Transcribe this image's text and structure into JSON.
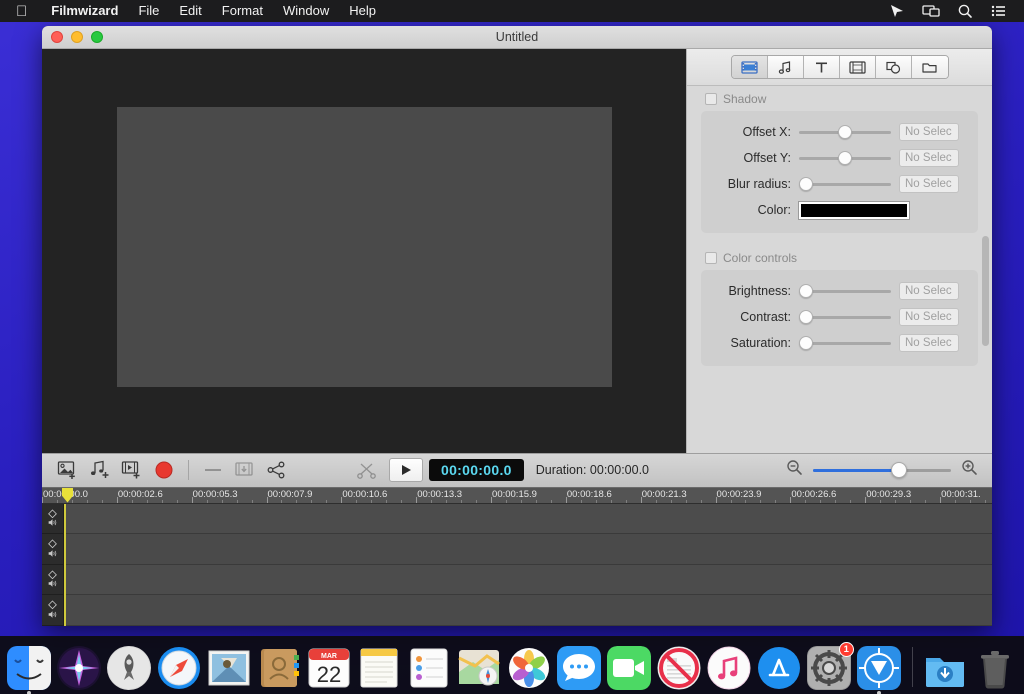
{
  "menubar": {
    "apple_glyph": " ",
    "items": [
      {
        "label": "Filmwizard",
        "bold": true
      },
      {
        "label": "File"
      },
      {
        "label": "Edit"
      },
      {
        "label": "Format"
      },
      {
        "label": "Window"
      },
      {
        "label": "Help"
      }
    ],
    "status_icons": [
      "pointer-icon",
      "screen-mirroring-icon",
      "search-icon",
      "control-center-icon"
    ]
  },
  "window": {
    "title": "Untitled",
    "traffic_lights": [
      "close",
      "minimize",
      "zoom"
    ]
  },
  "inspector": {
    "tabs": [
      {
        "name": "video-tab",
        "icon": "film-video-icon",
        "active": true
      },
      {
        "name": "audio-tab",
        "icon": "music-note-icon",
        "active": false
      },
      {
        "name": "text-tab",
        "icon": "text-t-icon",
        "active": false
      },
      {
        "name": "clip-tab",
        "icon": "film-strip-icon",
        "active": false
      },
      {
        "name": "shapes-tab",
        "icon": "shapes-icon",
        "active": false
      },
      {
        "name": "media-tab",
        "icon": "folder-icon",
        "active": false
      }
    ],
    "sections": [
      {
        "name": "shadow",
        "title": "Shadow",
        "checked": false,
        "rows": [
          {
            "label": "Offset X:",
            "type": "slider",
            "thumb_pct": 42,
            "value": "No Selec"
          },
          {
            "label": "Offset Y:",
            "type": "slider",
            "thumb_pct": 42,
            "value": "No Selec"
          },
          {
            "label": "Blur radius:",
            "type": "slider",
            "thumb_pct": 2,
            "value": "No Selec"
          },
          {
            "label": "Color:",
            "type": "color",
            "color": "#000000"
          }
        ]
      },
      {
        "name": "color-controls",
        "title": "Color controls",
        "checked": false,
        "rows": [
          {
            "label": "Brightness:",
            "type": "slider",
            "thumb_pct": 2,
            "value": "No Selec"
          },
          {
            "label": "Contrast:",
            "type": "slider",
            "thumb_pct": 2,
            "value": "No Selec"
          },
          {
            "label": "Saturation:",
            "type": "slider",
            "thumb_pct": 2,
            "value": "No Selec"
          }
        ]
      }
    ]
  },
  "transport": {
    "left_buttons": [
      {
        "name": "add-image-button",
        "icon": "add-image-icon"
      },
      {
        "name": "add-audio-button",
        "icon": "add-audio-icon"
      },
      {
        "name": "add-video-button",
        "icon": "add-video-icon"
      },
      {
        "name": "record-button",
        "icon": "record-icon",
        "color": "#e8382f"
      },
      {
        "name": "divider-button",
        "icon": "minus-icon"
      },
      {
        "name": "export-button",
        "icon": "export-clip-icon",
        "disabled": true
      },
      {
        "name": "share-button",
        "icon": "share-icon"
      }
    ],
    "split_button": {
      "name": "split-button",
      "icon": "scissors-icon",
      "disabled": true
    },
    "play_button": {
      "name": "play-button",
      "icon": "play-icon"
    },
    "timecode": "00:00:00.0",
    "duration_label": "Duration: 00:00:00.0",
    "zoom_out_icon": "zoom-out-icon",
    "zoom_in_icon": "zoom-in-icon",
    "zoom_value_pct": 62
  },
  "timeline": {
    "ruler_labels": [
      "00:00:00.0",
      "00:00:02.6",
      "00:00:05.3",
      "00:00:07.9",
      "00:00:10.6",
      "00:00:13.3",
      "00:00:15.9",
      "00:00:18.6",
      "00:00:21.3",
      "00:00:23.9",
      "00:00:26.6",
      "00:00:29.3",
      "00:00:31."
    ],
    "playhead_position": "00:00:00.0",
    "tracks": [
      {
        "name": "track-1",
        "keyframe_icon": "diamond-keyframe-icon",
        "volume_icon": "speaker-icon"
      },
      {
        "name": "track-2",
        "keyframe_icon": "diamond-keyframe-icon",
        "volume_icon": "speaker-icon"
      },
      {
        "name": "track-3",
        "keyframe_icon": "diamond-keyframe-icon",
        "volume_icon": "speaker-icon"
      },
      {
        "name": "track-4",
        "keyframe_icon": "diamond-keyframe-icon",
        "volume_icon": "speaker-icon"
      }
    ]
  },
  "dock": {
    "items": [
      {
        "name": "finder",
        "icon": "finder-icon",
        "running": true
      },
      {
        "name": "siri",
        "icon": "siri-icon",
        "running": false
      },
      {
        "name": "launchpad",
        "icon": "launchpad-icon",
        "running": false
      },
      {
        "name": "safari",
        "icon": "safari-icon",
        "running": false
      },
      {
        "name": "mail",
        "icon": "mail-icon",
        "running": false
      },
      {
        "name": "contacts",
        "icon": "contacts-icon",
        "running": false
      },
      {
        "name": "calendar",
        "icon": "calendar-icon",
        "running": false,
        "month": "MAR",
        "day": "22"
      },
      {
        "name": "notes",
        "icon": "notes-icon",
        "running": false
      },
      {
        "name": "reminders",
        "icon": "reminders-icon",
        "running": false
      },
      {
        "name": "maps",
        "icon": "maps-icon",
        "running": false
      },
      {
        "name": "photos",
        "icon": "photos-icon",
        "running": false
      },
      {
        "name": "messages",
        "icon": "messages-icon",
        "running": false
      },
      {
        "name": "facetime",
        "icon": "facetime-icon",
        "running": false
      },
      {
        "name": "news",
        "icon": "news-icon",
        "running": false
      },
      {
        "name": "itunes",
        "icon": "itunes-icon",
        "running": false
      },
      {
        "name": "app-store",
        "icon": "app-store-icon",
        "running": false
      },
      {
        "name": "system-preferences",
        "icon": "gear-icon",
        "running": false,
        "badge": "1"
      },
      {
        "name": "filmwizard",
        "icon": "filmwizard-icon",
        "running": true
      },
      {
        "name": "downloads",
        "icon": "downloads-folder-icon",
        "running": false
      },
      {
        "name": "trash",
        "icon": "trash-icon",
        "running": false
      }
    ]
  }
}
